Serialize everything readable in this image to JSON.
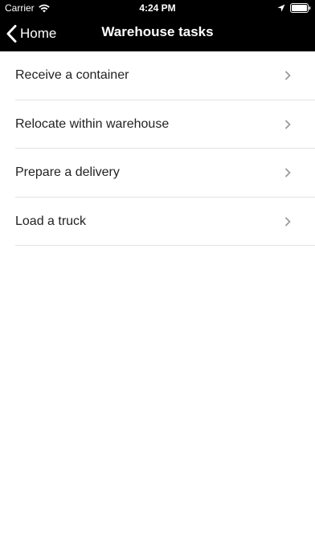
{
  "colors": {
    "nav_background": "#000000",
    "nav_text": "#ffffff",
    "list_text": "#222222",
    "separator": "#e3e3e3",
    "chevron": "#9a9a9a"
  },
  "status_bar": {
    "carrier": "Carrier",
    "time": "4:24 PM",
    "icons": [
      "wifi-icon",
      "location-icon",
      "battery-icon"
    ]
  },
  "nav_bar": {
    "back_label": "Home",
    "back_icon": "chevron-left-icon",
    "title": "Warehouse tasks"
  },
  "tasks": [
    {
      "label": "Receive a container",
      "icon": "chevron-right-icon"
    },
    {
      "label": "Relocate within warehouse",
      "icon": "chevron-right-icon"
    },
    {
      "label": "Prepare a delivery",
      "icon": "chevron-right-icon"
    },
    {
      "label": "Load a truck",
      "icon": "chevron-right-icon"
    }
  ]
}
